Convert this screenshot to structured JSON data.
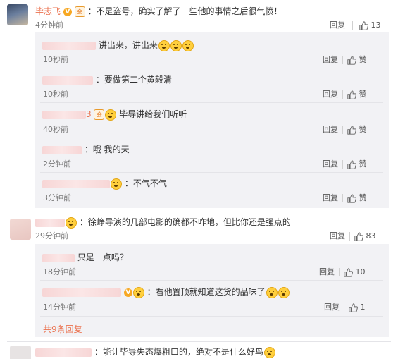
{
  "colors": {
    "name": "#eb7350",
    "reply_bg": "#f2f2f5",
    "text": "#333333",
    "meta": "#777777"
  },
  "labels": {
    "reply": "回复",
    "like": "赞"
  },
  "main_comment": {
    "author": "毕志飞",
    "text": "：不是盗号，确实了解了一些他的事情之后很气愤！",
    "time": "4分钟前",
    "likes": "13",
    "replies": [
      {
        "text": "讲出来，讲出来",
        "time": "10秒前",
        "emoji_count": 3
      },
      {
        "text": "：要做第二个黄毅清",
        "time": "10秒前"
      },
      {
        "name_suffix": "3",
        "text": "毕导讲给我们听听",
        "time": "40秒前"
      },
      {
        "text": "：哦  我的天",
        "time": "2分钟前"
      },
      {
        "text": "：不气不气",
        "time": "3分钟前"
      }
    ]
  },
  "second_comment": {
    "text": "：徐峥导演的几部电影的确都不咋地，但比你还是强点的",
    "time": "29分钟前",
    "likes": "83",
    "replies": [
      {
        "text": "只是一点吗？",
        "time": "18分钟前",
        "likes": "10"
      },
      {
        "text": "：看他置顶就知道这货的品味了",
        "time": "14分钟前",
        "likes": "1"
      }
    ],
    "more_replies": "共9条回复"
  },
  "third_comment": {
    "text": "：能让毕导失态爆粗口的，绝对不是什么好鸟"
  }
}
